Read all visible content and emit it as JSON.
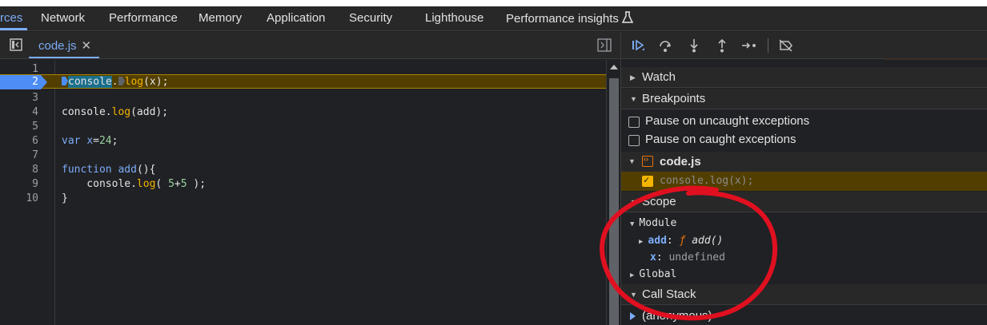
{
  "tabs": [
    {
      "label": "rces",
      "active": true
    },
    {
      "label": "Network"
    },
    {
      "label": "Performance"
    },
    {
      "label": "Memory"
    },
    {
      "label": "Application"
    },
    {
      "label": "Security"
    },
    {
      "label": "Lighthouse"
    },
    {
      "label": "Performance insights"
    }
  ],
  "icons": {
    "flask": "experiment-flask-icon",
    "navigator": "navigator-toggle-icon",
    "debugger_toggle": "debugger-sidebar-toggle-icon",
    "resume": "resume-icon",
    "step_over": "step-over-icon",
    "step_into": "step-into-icon",
    "step_out": "step-out-icon",
    "step": "step-icon",
    "deactivate": "deactivate-breakpoints-icon"
  },
  "editor": {
    "file_tab": "code.js",
    "close": "✕",
    "lines": [
      {
        "n": "1",
        "code": ""
      },
      {
        "n": "2",
        "code": "console.log(x);",
        "paused": true
      },
      {
        "n": "3",
        "code": ""
      },
      {
        "n": "4",
        "code": "console.log(add);"
      },
      {
        "n": "5",
        "code": ""
      },
      {
        "n": "6",
        "code": "var x=24;"
      },
      {
        "n": "7",
        "code": ""
      },
      {
        "n": "8",
        "code": "function add(){"
      },
      {
        "n": "9",
        "code": "    console.log( 5+5 );"
      },
      {
        "n": "10",
        "code": "}"
      }
    ]
  },
  "sidebar": {
    "watch": "Watch",
    "breakpoints": "Breakpoints",
    "pause_uncaught": "Pause on uncaught exceptions",
    "pause_caught": "Pause on caught exceptions",
    "bp_file": "code.js",
    "bp_code": "console.log(x);",
    "scope": "Scope",
    "module": "Module",
    "add_prop": "add",
    "add_colon": ":",
    "f_symbol": "ƒ",
    "add_value": "add()",
    "x_prop": "x",
    "x_colon": ":",
    "x_value": "undefined",
    "global": "Global",
    "call_stack": "Call Stack",
    "anonymous": "(anonymous)"
  },
  "colors": {
    "accent": "#7cacf8",
    "paused_line": "#523f00",
    "annotation": "#e01020"
  }
}
